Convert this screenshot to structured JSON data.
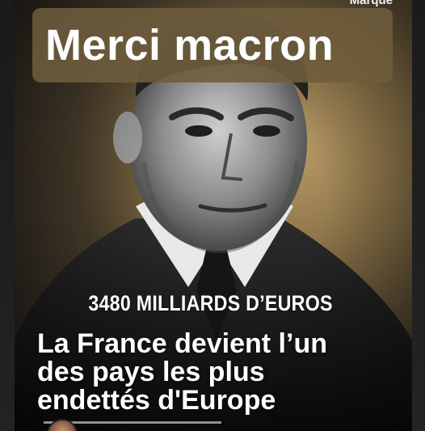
{
  "caption": {
    "text": "Merci macron"
  },
  "brand": {
    "label": "Marque"
  },
  "headline": {
    "amount": "3480 MILLIARDS D’EUROS",
    "lines": [
      "La France devient l’un",
      "des pays les plus",
      "endettés d'Europe"
    ]
  },
  "colors": {
    "caption_bg": "#6e5c3c",
    "text": "#ffffff",
    "background": "#1f1f1f"
  }
}
